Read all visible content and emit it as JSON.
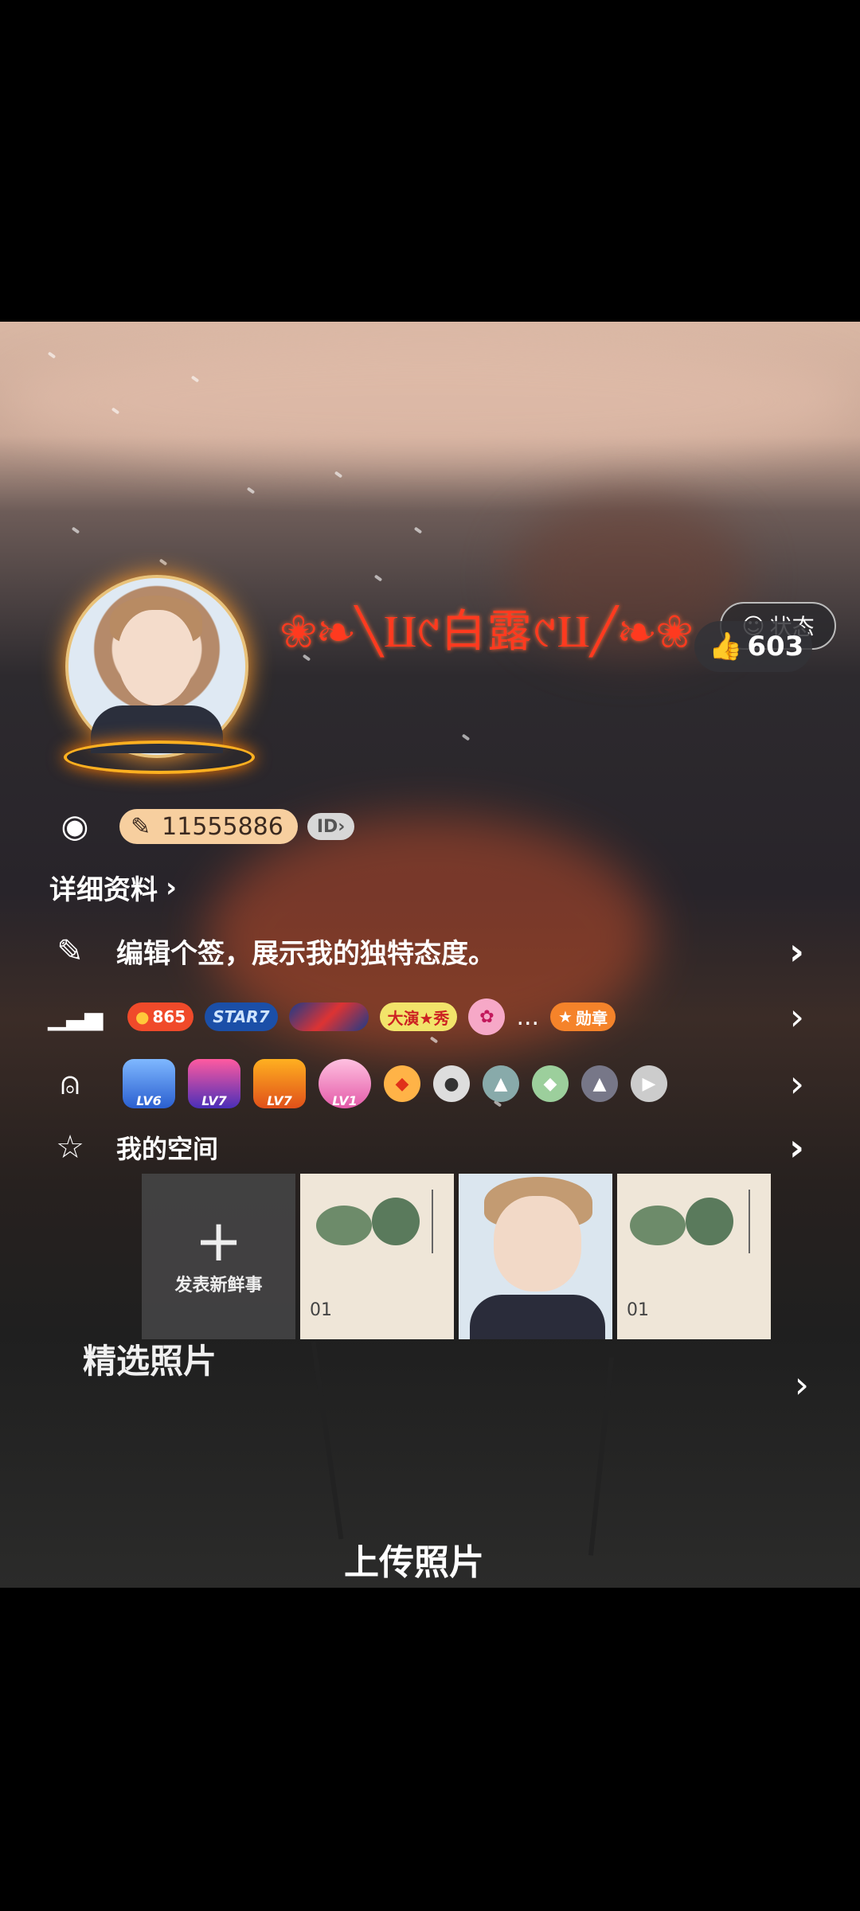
{
  "profile": {
    "name": "❀❧╲⨿୯白露୯⨿╱❧❀",
    "status_label": "状态",
    "likes": "603",
    "qq_number": "11555886",
    "id_badge": "ID",
    "detail_link": "详细资料",
    "signature_prompt": "编辑个签，展示我的独特态度。"
  },
  "badges": {
    "score": "865",
    "star_label": "STAR7",
    "show_label": "大演★秀",
    "more": "...",
    "medal_label": "勋章"
  },
  "levels": [
    "LV6",
    "LV7",
    "LV7",
    "LV1"
  ],
  "space": {
    "title": "我的空间",
    "post_label": "发表新鲜事",
    "thumb_number": "01"
  },
  "photos": {
    "title": "精选照片",
    "upload_label": "上传照片"
  },
  "colors": {
    "name": "#ff3a1f",
    "qq_badge_bg": "#f7cf9f",
    "score_badge": "#f04a2a",
    "medal": "#f5832a"
  }
}
